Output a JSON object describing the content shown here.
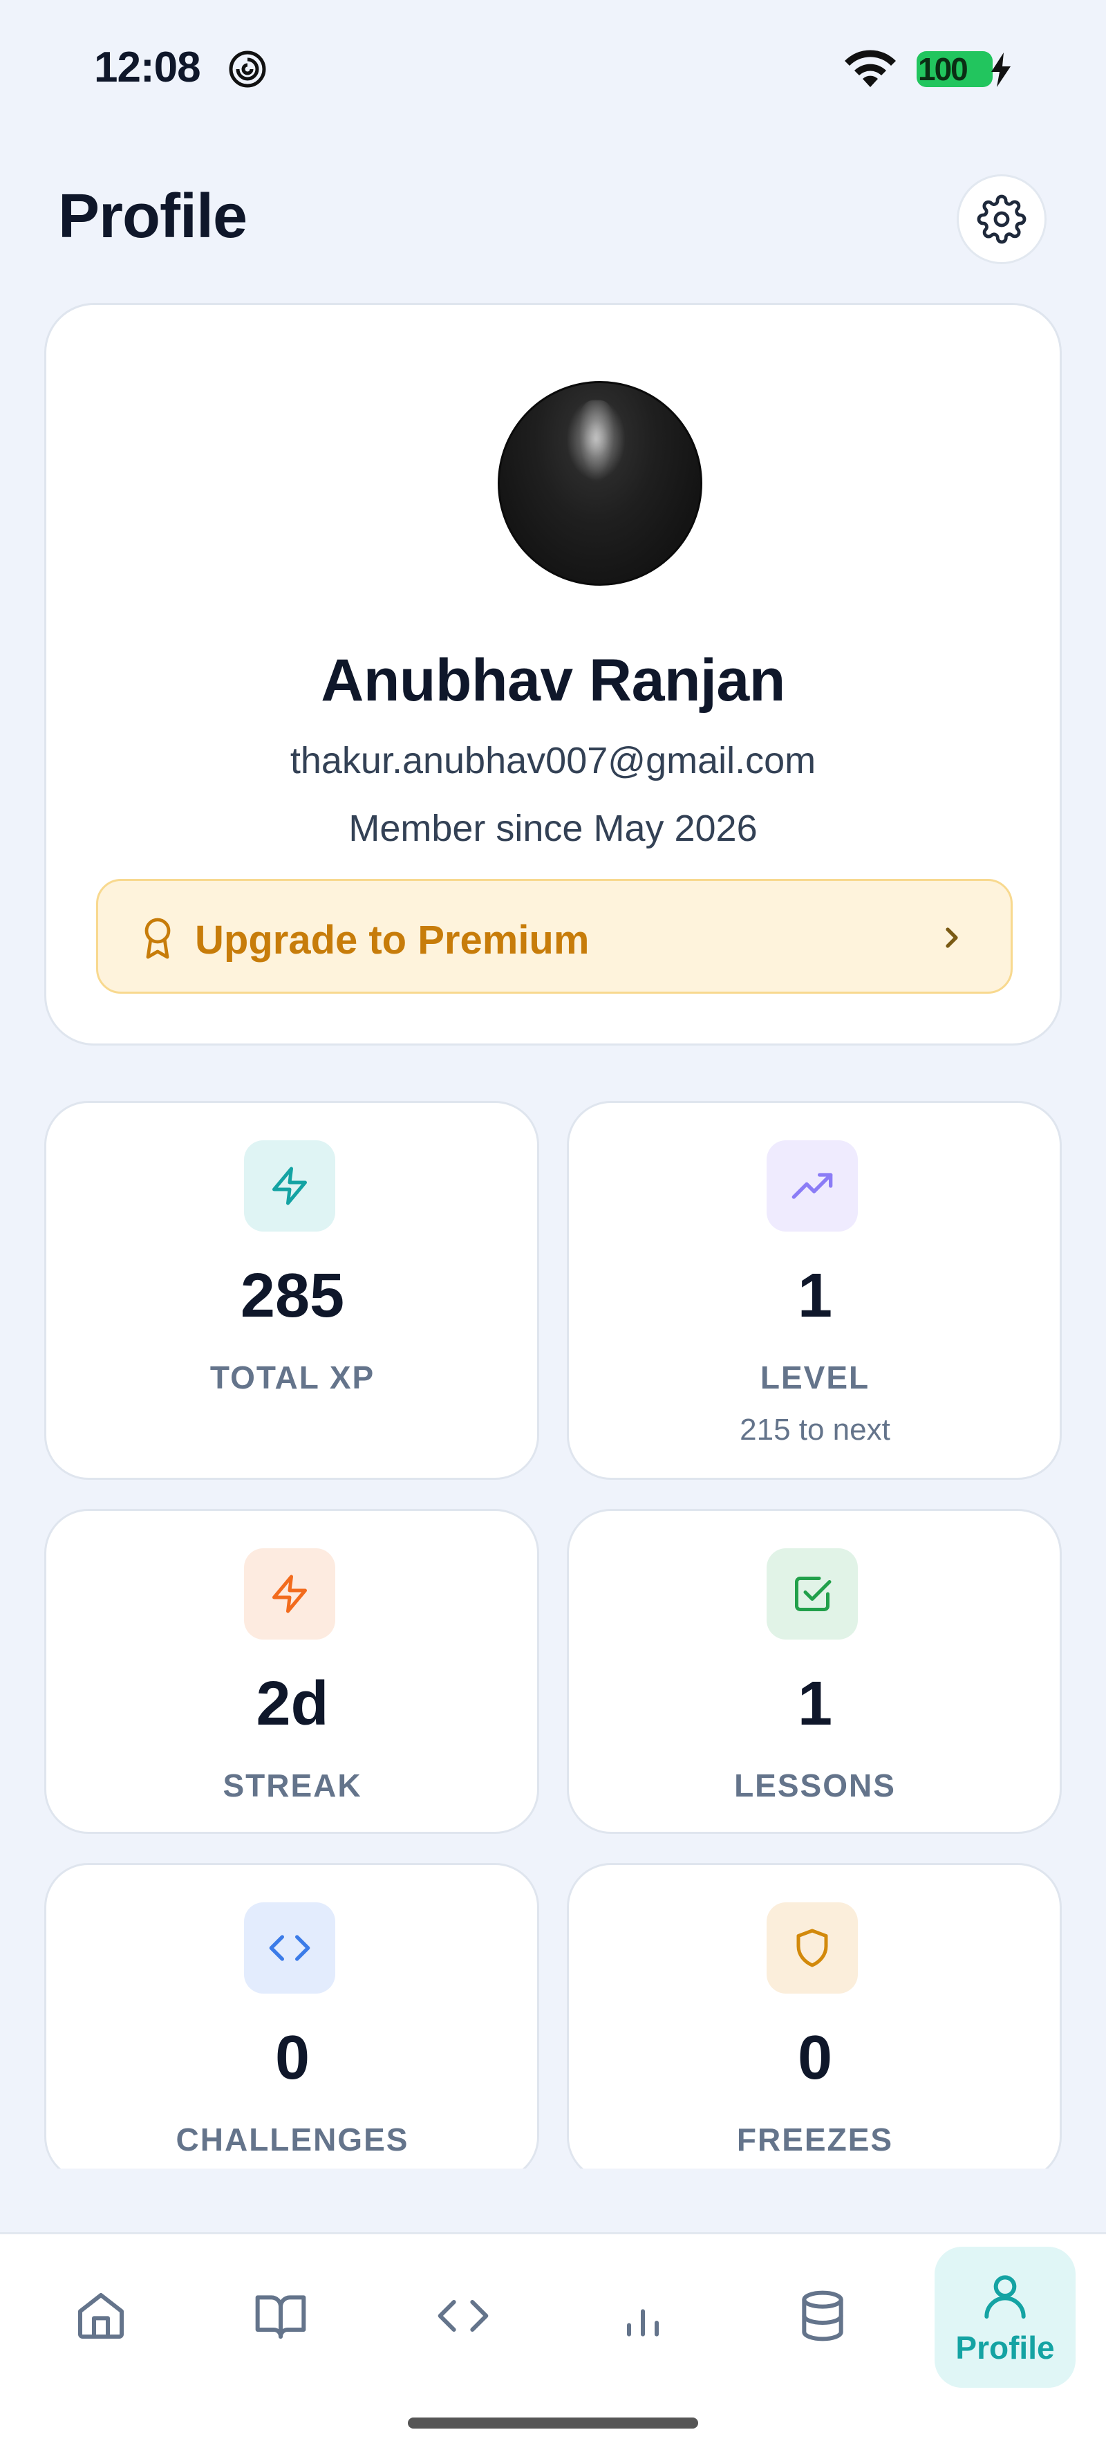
{
  "status_bar": {
    "time": "12:08",
    "battery": "100"
  },
  "header": {
    "title": "Profile"
  },
  "profile": {
    "name": "Anubhav Ranjan",
    "email": "thakur.anubhav007@gmail.com",
    "member_since": "Member since May 2026",
    "premium_label": "Upgrade to Premium"
  },
  "stats": [
    {
      "value": "285",
      "label": "TOTAL XP",
      "sub": "",
      "icon": "lightning-icon",
      "icon_bg": "#dff4f4",
      "icon_color": "#14a3a3"
    },
    {
      "value": "1",
      "label": "LEVEL",
      "sub": "215 to next",
      "icon": "trending-up-icon",
      "icon_bg": "#efebfe",
      "icon_color": "#8b7cf6"
    },
    {
      "value": "2d",
      "label": "STREAK",
      "sub": "",
      "icon": "lightning-icon",
      "icon_bg": "#fdebe0",
      "icon_color": "#f26b1d"
    },
    {
      "value": "1",
      "label": "LESSONS",
      "sub": "",
      "icon": "check-square-icon",
      "icon_bg": "#e1f3e7",
      "icon_color": "#22a04b"
    },
    {
      "value": "0",
      "label": "CHALLENGES",
      "sub": "",
      "icon": "code-icon",
      "icon_bg": "#e3ecfd",
      "icon_color": "#3b7be8"
    },
    {
      "value": "0",
      "label": "FREEZES",
      "sub": "",
      "icon": "shield-icon",
      "icon_bg": "#fbeedb",
      "icon_color": "#d2890b"
    }
  ],
  "nav": {
    "items": [
      {
        "name": "home",
        "icon": "home-icon"
      },
      {
        "name": "learn",
        "icon": "book-icon"
      },
      {
        "name": "code",
        "icon": "code-icon"
      },
      {
        "name": "stats",
        "icon": "bar-chart-icon"
      },
      {
        "name": "database",
        "icon": "database-icon"
      },
      {
        "name": "profile",
        "icon": "user-icon",
        "label": "Profile",
        "active": true
      }
    ]
  },
  "colors": {
    "accent": "#14a3a3",
    "premium": "#c77c0a",
    "background": "#eff3fb"
  }
}
